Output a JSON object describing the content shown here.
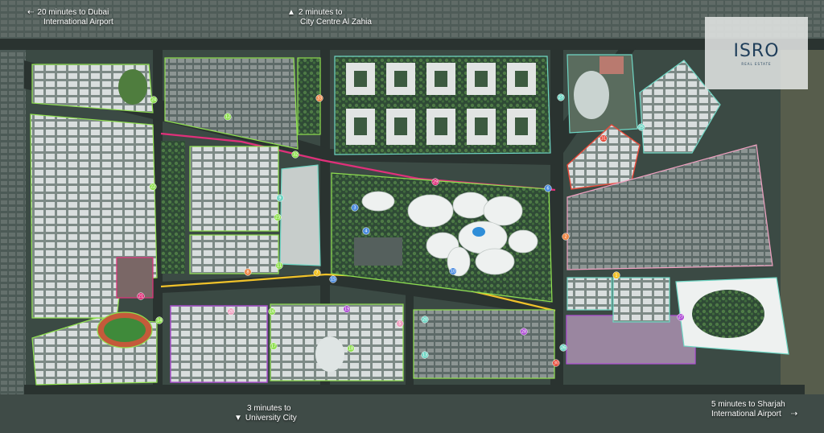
{
  "logo": {
    "brand": "ISRO",
    "sub": "REAL ESTATE"
  },
  "navigation": {
    "dubai_airport": {
      "direction": "left",
      "line1": "20 minutes to Dubai",
      "line2": "International Airport"
    },
    "city_centre": {
      "direction": "up",
      "line1": "2 minutes to",
      "line2": "City Centre Al Zahia"
    },
    "university_city": {
      "direction": "down",
      "line1": "3 minutes to",
      "line2": "University City"
    },
    "sharjah_airport": {
      "direction": "right",
      "line1": "5 minutes to Sharjah",
      "line2": "International Airport"
    }
  },
  "zone_colors": {
    "green": "#8fe04f",
    "teal": "#6fd6c4",
    "magenta": "#e0307a",
    "yellow": "#f0c22a",
    "purple": "#b04fd6",
    "red": "#e84a3a",
    "pink": "#f0a0c0",
    "orange": "#f08a4a",
    "blue": "#4f8ee0"
  },
  "plot_markers": [
    {
      "n": "24",
      "c": "green"
    },
    {
      "n": "12",
      "c": "green"
    },
    {
      "n": "22",
      "c": "green"
    },
    {
      "n": "27",
      "c": "teal"
    },
    {
      "n": "25",
      "c": "teal"
    },
    {
      "n": "31",
      "c": "red"
    },
    {
      "n": "32",
      "c": "green"
    },
    {
      "n": "29",
      "c": "magenta"
    },
    {
      "n": "23",
      "c": "green"
    },
    {
      "n": "9",
      "c": "teal"
    },
    {
      "n": "11",
      "c": "green"
    },
    {
      "n": "21",
      "c": "magenta"
    },
    {
      "n": "14",
      "c": "green"
    },
    {
      "n": "8",
      "c": "orange"
    },
    {
      "n": "7",
      "c": "yellow"
    },
    {
      "n": "6",
      "c": "blue"
    },
    {
      "n": "2",
      "c": "orange"
    },
    {
      "n": "3",
      "c": "blue"
    },
    {
      "n": "4",
      "c": "blue"
    },
    {
      "n": "15",
      "c": "blue"
    },
    {
      "n": "27",
      "c": "purple"
    },
    {
      "n": "20",
      "c": "pink"
    },
    {
      "n": "16",
      "c": "green"
    },
    {
      "n": "17",
      "c": "green"
    },
    {
      "n": "18",
      "c": "green"
    },
    {
      "n": "19",
      "c": "purple"
    },
    {
      "n": "20",
      "c": "teal"
    },
    {
      "n": "13",
      "c": "teal"
    },
    {
      "n": "26",
      "c": "teal"
    },
    {
      "n": "30",
      "c": "red"
    },
    {
      "n": "5",
      "c": "pink"
    },
    {
      "n": "28",
      "c": "purple"
    },
    {
      "n": "10",
      "c": "blue"
    },
    {
      "n": "1",
      "c": "yellow"
    },
    {
      "n": "33",
      "c": "orange"
    }
  ]
}
